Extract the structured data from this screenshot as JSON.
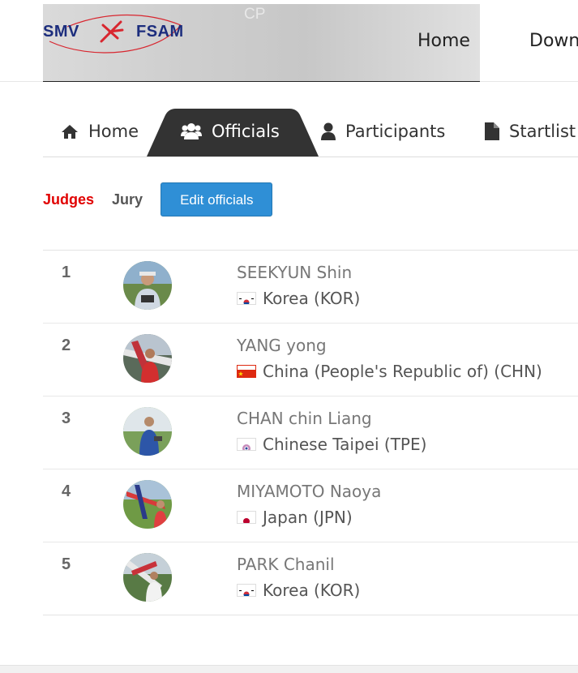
{
  "header": {
    "logo": {
      "left_text": "SMV",
      "right_text": "FSAM"
    },
    "banner_ghost_text": "CP",
    "nav": [
      "Home",
      "Down"
    ]
  },
  "tabs": [
    {
      "label": "Home",
      "icon": "home-icon"
    },
    {
      "label": "Officials",
      "icon": "users-icon",
      "active": true
    },
    {
      "label": "Participants",
      "icon": "user-icon"
    },
    {
      "label": "Startlist",
      "icon": "file-icon"
    }
  ],
  "subnav": {
    "judges": "Judges",
    "jury": "Jury",
    "edit_button": "Edit officials"
  },
  "officials": [
    {
      "rank": "1",
      "name": "SEEKYUN  Shin",
      "country": "Korea (KOR)",
      "flag": "kor"
    },
    {
      "rank": "2",
      "name": "YANG  yong",
      "country": "China (People's Republic of) (CHN)",
      "flag": "chn"
    },
    {
      "rank": "3",
      "name": "CHAN  chin Liang",
      "country": "Chinese Taipei (TPE)",
      "flag": "tpe"
    },
    {
      "rank": "4",
      "name": "MIYAMOTO  Naoya",
      "country": "Japan (JPN)",
      "flag": "jpn"
    },
    {
      "rank": "5",
      "name": "PARK  Chanil",
      "country": "Korea (KOR)",
      "flag": "kor"
    }
  ],
  "colors": {
    "accent_blue": "#2f8fd6",
    "active_red": "#e10000",
    "tab_active_bg": "#333333",
    "logo_blue": "#1c2d7d",
    "logo_red": "#d8262f"
  }
}
